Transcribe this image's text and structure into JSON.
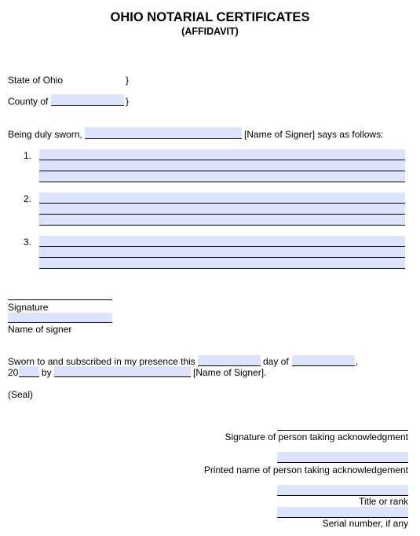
{
  "document": {
    "title": "OHIO NOTARIAL CERTIFICATES",
    "subtitle": "(AFFIDAVIT)"
  },
  "venue": {
    "state_label": "State of Ohio",
    "brace": "}",
    "county_label": "County of",
    "county_value": ""
  },
  "statement": {
    "prefix": "Being duly sworn,",
    "signer_value": "",
    "suffix": "[Name of Signer] says as follows:",
    "items": [
      {
        "number": "1.",
        "value": ""
      },
      {
        "number": "2.",
        "value": ""
      },
      {
        "number": "3.",
        "value": ""
      }
    ]
  },
  "signer_block": {
    "signature_label": "Signature",
    "name_label": "Name of signer",
    "name_value": ""
  },
  "jurat": {
    "text1": "Sworn to and subscribed in my presence this",
    "day_value": "",
    "text2": "day of",
    "month_value": "",
    "comma": ",",
    "year_prefix": "20",
    "year_value": "",
    "by_label": "by",
    "signer_value": "",
    "suffix": "[Name of Signer]."
  },
  "seal": "(Seal)",
  "officer": {
    "signature_label": "Signature of person taking acknowledgment",
    "printed_name_label": "Printed name of person taking acknowledgement",
    "title_label": "Title or rank",
    "serial_label": "Serial number, if any"
  },
  "colors": {
    "field_fill": "#dce3fc"
  }
}
